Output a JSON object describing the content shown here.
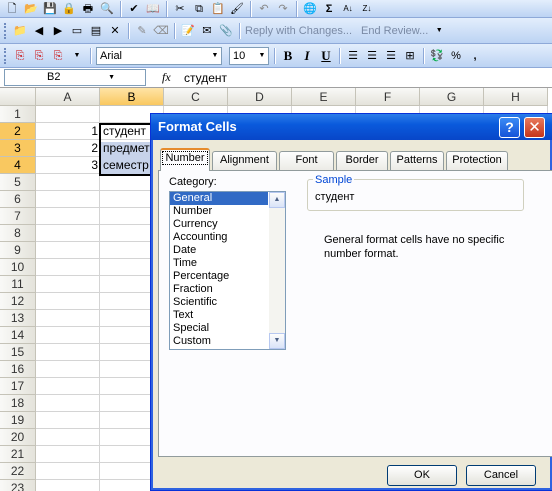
{
  "toolbar_top": {
    "icons": [
      "new-icon",
      "open-icon",
      "save-icon",
      "permission-icon",
      "print-icon",
      "print-preview-icon",
      "spelling-icon",
      "research-icon",
      "cut-icon",
      "copy-icon",
      "paste-icon",
      "format-painter-icon",
      "undo-icon",
      "redo-icon",
      "hyperlink-icon",
      "autosum-icon",
      "sort-ascending-icon",
      "sort-descending-icon"
    ]
  },
  "toolbar_review": {
    "reply_label": "Reply with Changes...",
    "end_review_label": "End Review..."
  },
  "toolbar_format": {
    "font": "Arial",
    "size": "10",
    "bold": "B",
    "italic": "I",
    "underline": "U",
    "percent": "%",
    "comma": ","
  },
  "formula_bar": {
    "name_box": "B2",
    "fx": "fx",
    "value": "студент"
  },
  "columns": [
    "A",
    "B",
    "C",
    "D",
    "E",
    "F",
    "G",
    "H"
  ],
  "rows": [
    "1",
    "2",
    "3",
    "4",
    "5",
    "6",
    "7",
    "8",
    "9",
    "10",
    "11",
    "12",
    "13",
    "14",
    "15",
    "16",
    "17",
    "18",
    "19",
    "20",
    "21",
    "22",
    "23"
  ],
  "cells": {
    "a2": "1",
    "a3": "2",
    "a4": "3",
    "b2": "студент",
    "b3": "предмет",
    "b4": "семестр"
  },
  "dialog": {
    "title": "Format Cells",
    "help": "?",
    "close": "✕",
    "tabs": [
      "Number",
      "Alignment",
      "Font",
      "Border",
      "Patterns",
      "Protection"
    ],
    "category_label": "Category:",
    "categories": [
      "General",
      "Number",
      "Currency",
      "Accounting",
      "Date",
      "Time",
      "Percentage",
      "Fraction",
      "Scientific",
      "Text",
      "Special",
      "Custom"
    ],
    "sample_label": "Sample",
    "sample_value": "студент",
    "description": "General format cells have no specific number format.",
    "ok_label": "OK",
    "cancel_label": "Cancel"
  }
}
